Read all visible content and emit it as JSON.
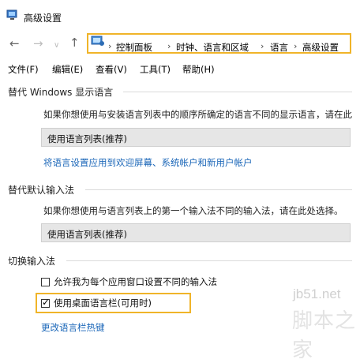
{
  "window": {
    "title": "高级设置"
  },
  "breadcrumb": [
    "控制面板",
    "时钟、语言和区域",
    "语言",
    "高级设置"
  ],
  "nav": {
    "back": "←",
    "forward": "→",
    "dropdown": "∨",
    "up": "↑",
    "separator": "›"
  },
  "menu": [
    "文件(F)",
    "编辑(E)",
    "查看(V)",
    "工具(T)",
    "帮助(H)"
  ],
  "sections": {
    "display_language": {
      "title": "替代 Windows 显示语言",
      "desc": "如果你想使用与安装语言列表中的顺序所确定的语言不同的显示语言，请在此",
      "combo_value": "使用语言列表(推荐)",
      "link": "将语言设置应用到欢迎屏幕、系统帐户和新用户帐户"
    },
    "input_method": {
      "title": "替代默认输入法",
      "desc": "如果你想使用与语言列表上的第一个输入法不同的输入法，请在此处选择。",
      "combo_value": "使用语言列表(推荐)"
    },
    "switch_input": {
      "title": "切换输入法",
      "options": [
        {
          "label": "允许我为每个应用窗口设置不同的输入法",
          "checked": false
        },
        {
          "label": "使用桌面语言栏(可用时)",
          "checked": true
        }
      ],
      "link": "更改语言栏热键"
    }
  },
  "watermark": {
    "url": "jb51.net",
    "name": "脚本之家"
  },
  "colors": {
    "highlight": "#f0b429",
    "link": "#1a66b8"
  }
}
